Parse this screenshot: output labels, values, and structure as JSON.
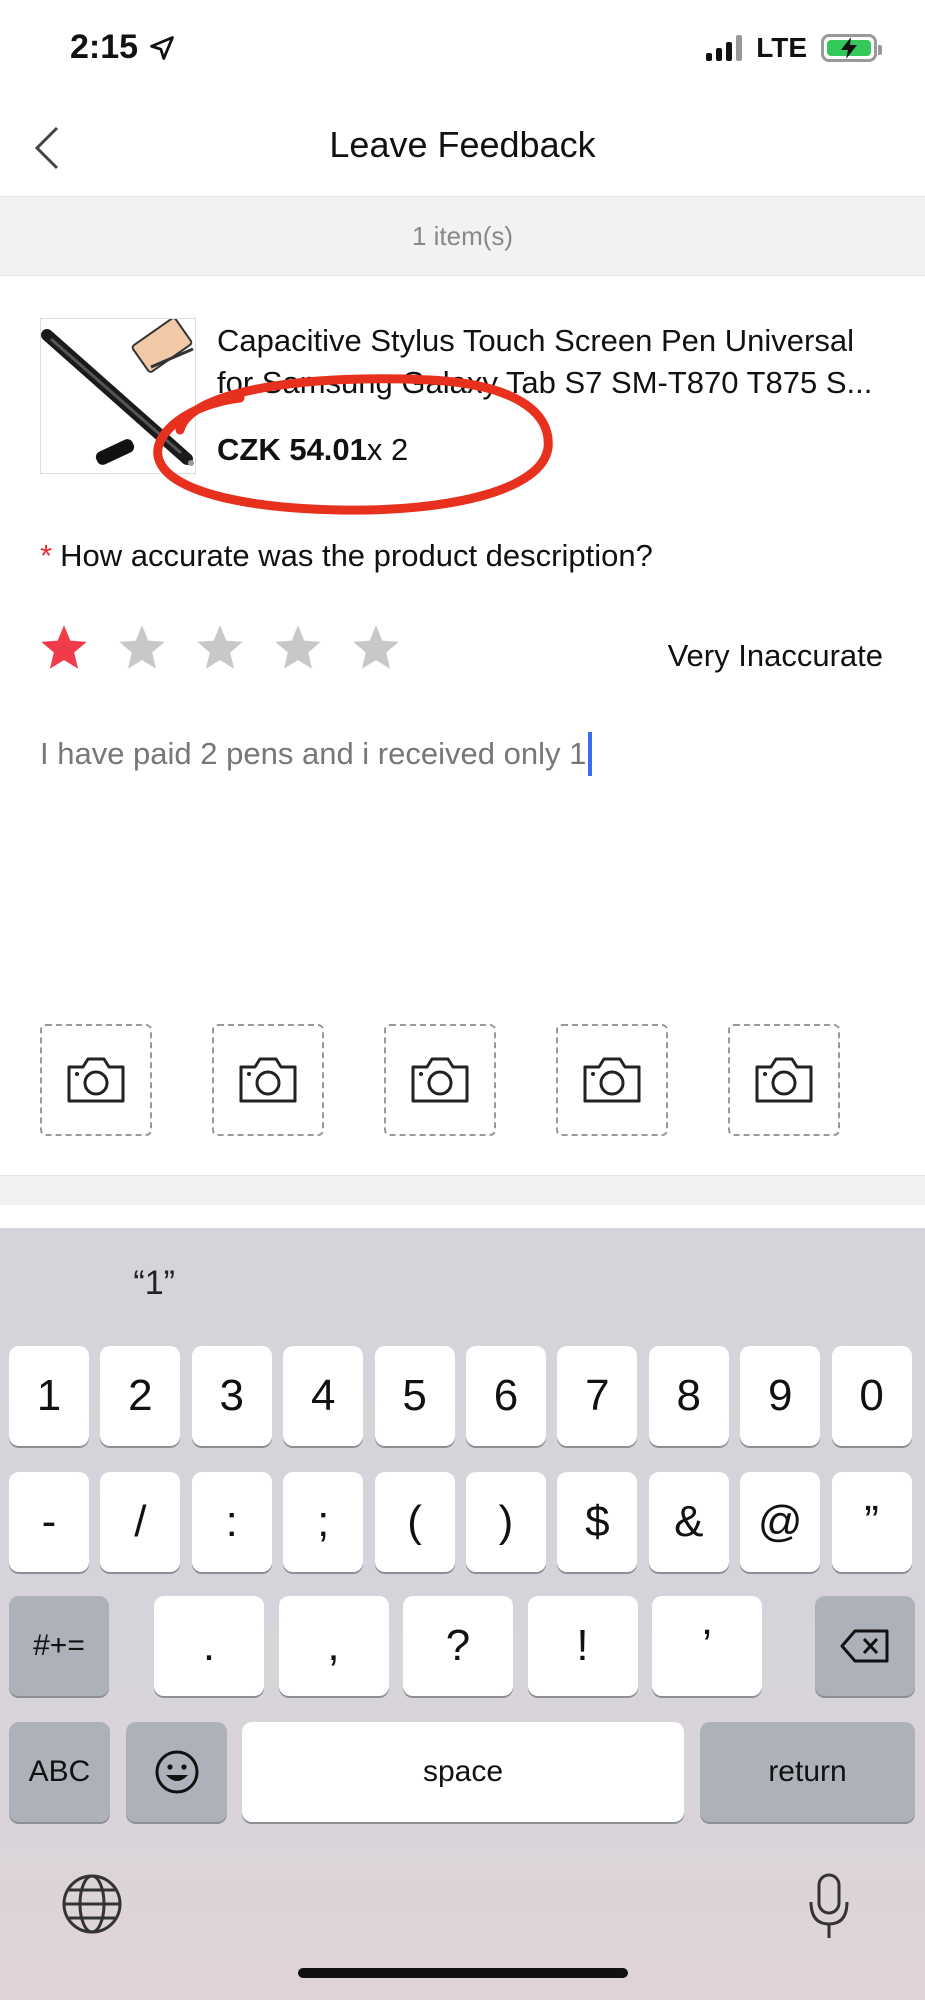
{
  "status_bar": {
    "time": "2:15",
    "network": "LTE"
  },
  "nav": {
    "title": "Leave Feedback"
  },
  "items_summary": "1 item(s)",
  "product": {
    "title": "Capacitive Stylus Touch Screen Pen Universal for Samsung Galaxy Tab S7 SM-T870 T875 S...",
    "price": "CZK 54.01",
    "quantity": "x 2"
  },
  "question": {
    "required_mark": "*",
    "text": "How accurate was the product description?"
  },
  "rating": {
    "value": 1,
    "max": 5,
    "label": "Very Inaccurate",
    "active_color": "#f03c48",
    "inactive_color": "#c8c8c8"
  },
  "feedback_text": "I have paid 2 pens and i received only 1",
  "photo_slots": 5,
  "keyboard": {
    "suggestion": "“1”",
    "row1": [
      "1",
      "2",
      "3",
      "4",
      "5",
      "6",
      "7",
      "8",
      "9",
      "0"
    ],
    "row2": [
      "-",
      "/",
      ":",
      ";",
      "(",
      ")",
      "$",
      "&",
      "@",
      "”"
    ],
    "row3": [
      ".",
      ",",
      "?",
      "!",
      "’"
    ],
    "shift_label": "#+=",
    "abc_label": "ABC",
    "space_label": "space",
    "return_label": "return"
  }
}
